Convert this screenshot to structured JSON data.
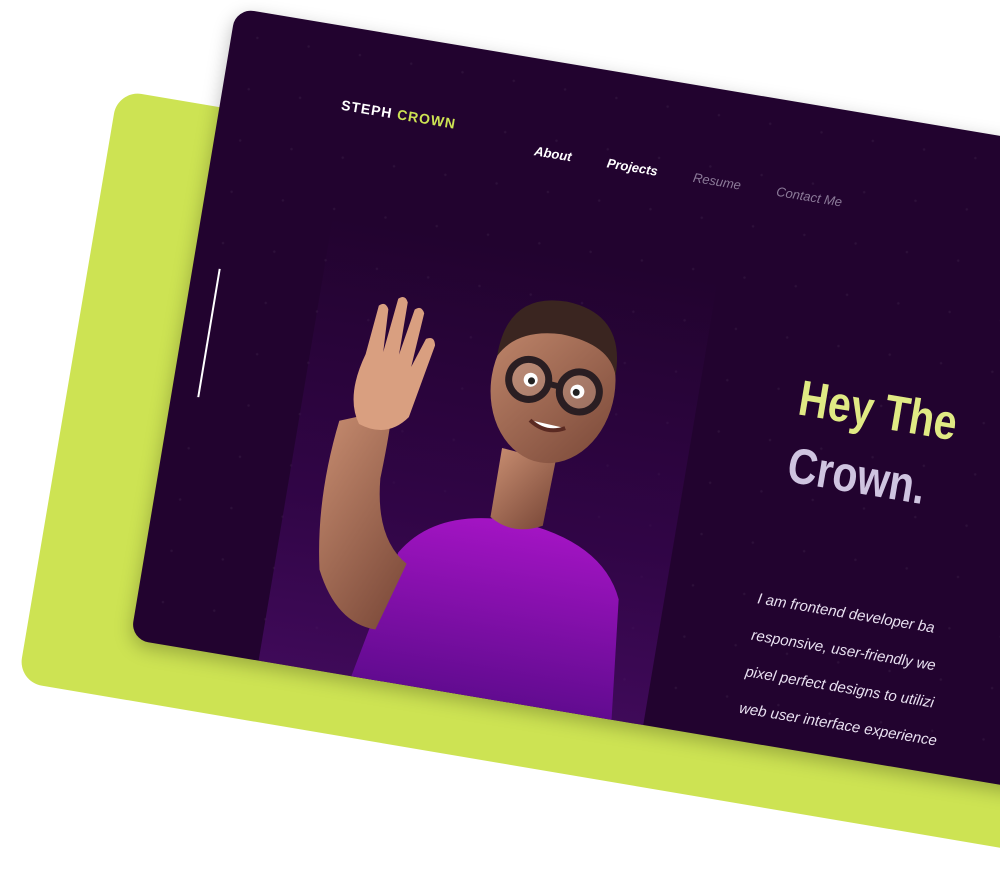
{
  "brand": {
    "first": "STEPH",
    "second": "CROWN",
    "accent_color": "#cde353",
    "background_color": "#22032f"
  },
  "nav": [
    {
      "label": "About"
    },
    {
      "label": "Projects"
    },
    {
      "label": "Resume"
    },
    {
      "label": "Contact Me"
    }
  ],
  "hero": {
    "headline_line1": "Hey The",
    "headline_line2": "Crown.",
    "bio_lines": [
      "I am frontend developer ba",
      "responsive, user-friendly we",
      "pixel perfect designs to utilizi",
      "web user interface experience"
    ]
  },
  "icons": {
    "avatar": "waving-3d-avatar"
  }
}
